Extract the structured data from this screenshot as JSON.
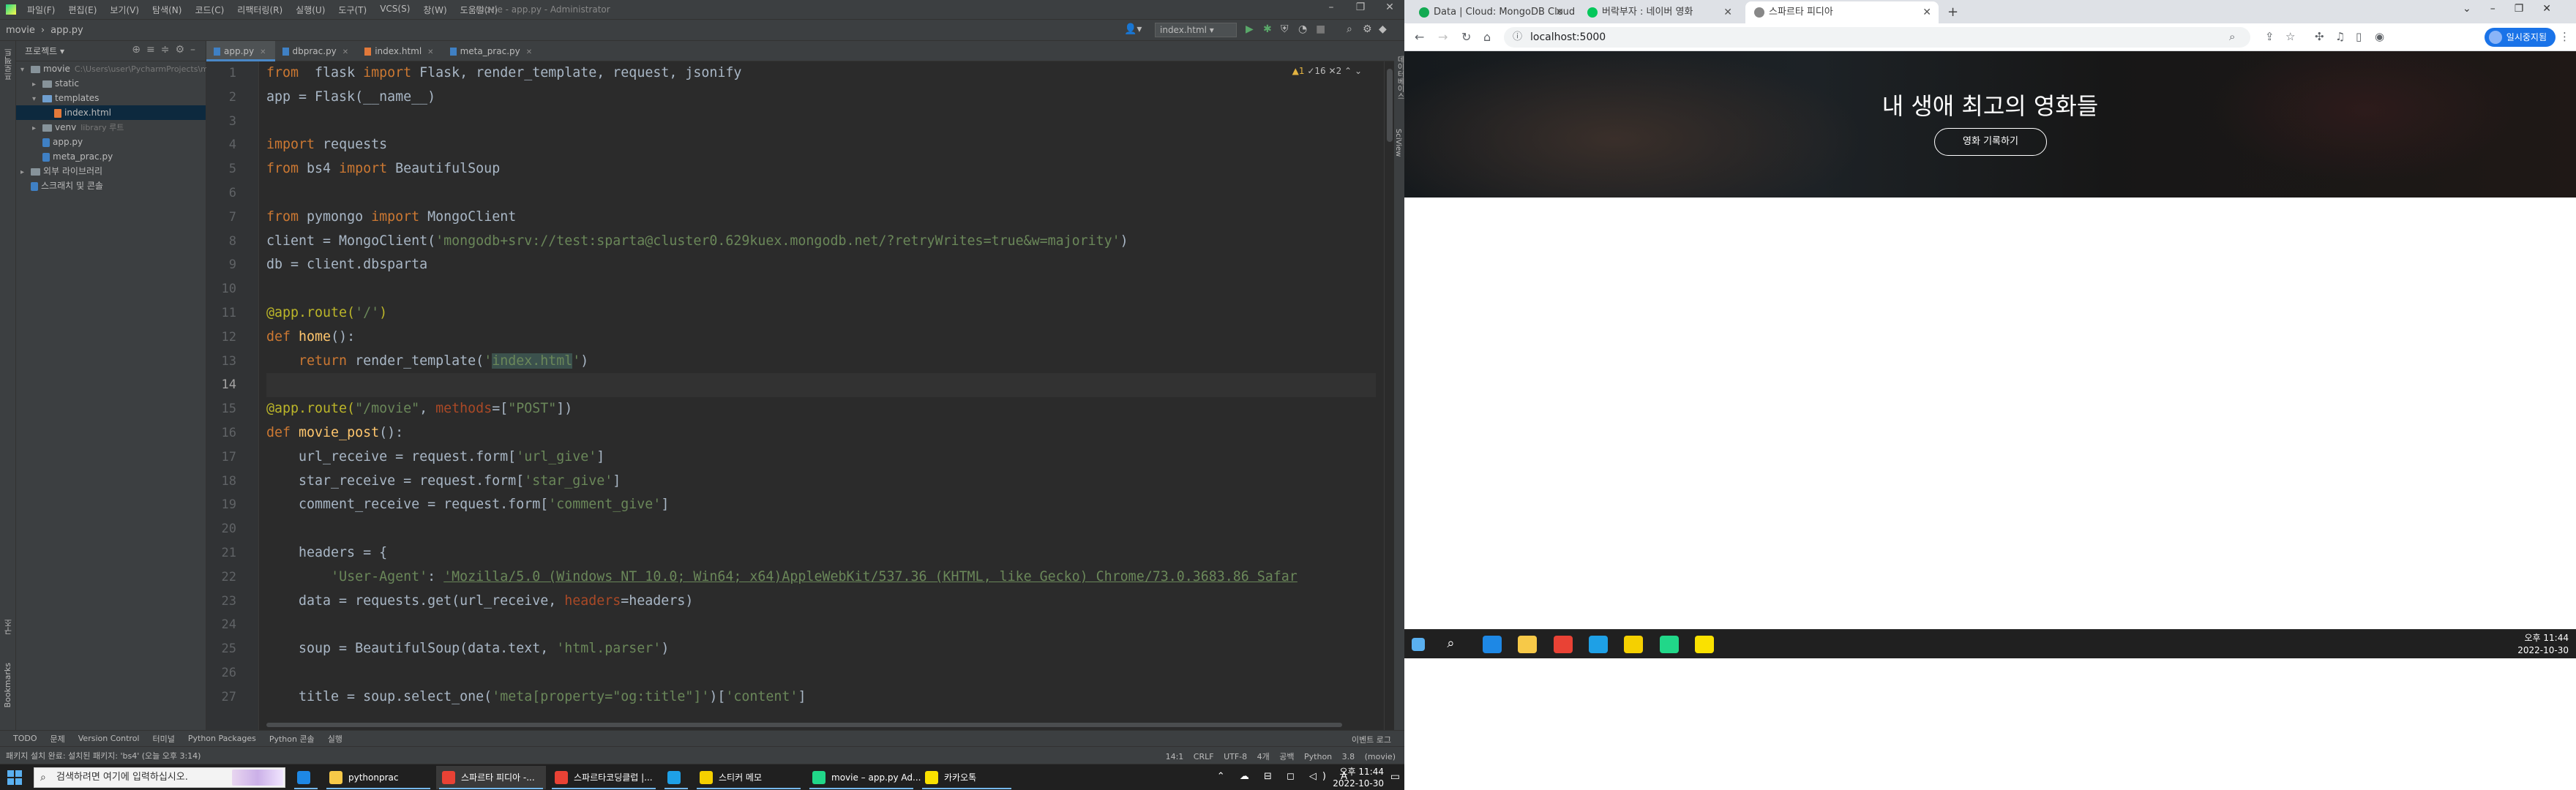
{
  "ide": {
    "menu": [
      "파일(F)",
      "편집(E)",
      "보기(V)",
      "탐색(N)",
      "코드(C)",
      "리팩터링(R)",
      "실행(U)",
      "도구(T)",
      "VCS(S)",
      "창(W)",
      "도움말(H)"
    ],
    "window_title": "movie - app.py - Administrator",
    "breadcrumb": [
      "movie",
      "app.py"
    ],
    "run_config": "index.html",
    "left_strip": [
      "프로젝트",
      "구조",
      "Bookmarks"
    ],
    "right_strip": [
      "데이터베이스",
      "SciView"
    ],
    "project_header": "프로젝트",
    "tree": [
      {
        "label": "movie",
        "hint": "C:\\Users\\user\\PycharmProjects\\movie",
        "kind": "folder",
        "depth": 0,
        "open": true
      },
      {
        "label": "static",
        "hint": "",
        "kind": "folder",
        "depth": 1,
        "open": false
      },
      {
        "label": "templates",
        "hint": "",
        "kind": "folder-blue",
        "depth": 1,
        "open": true
      },
      {
        "label": "index.html",
        "hint": "",
        "kind": "html",
        "depth": 2,
        "selected": true
      },
      {
        "label": "venv",
        "hint": "library 루트",
        "kind": "folder",
        "depth": 1,
        "open": false
      },
      {
        "label": "app.py",
        "hint": "",
        "kind": "py",
        "depth": 1
      },
      {
        "label": "meta_prac.py",
        "hint": "",
        "kind": "py",
        "depth": 1
      },
      {
        "label": "외부 라이브러리",
        "hint": "",
        "kind": "lib",
        "depth": 0,
        "open": false
      },
      {
        "label": "스크래치 및 콘솔",
        "hint": "",
        "kind": "scratch",
        "depth": 0
      }
    ],
    "tabs": [
      {
        "label": "app.py",
        "kind": "py",
        "active": true
      },
      {
        "label": "dbprac.py",
        "kind": "py",
        "active": false
      },
      {
        "label": "index.html",
        "kind": "html",
        "active": false
      },
      {
        "label": "meta_prac.py",
        "kind": "py",
        "active": false
      }
    ],
    "inspection": {
      "warnings": "▲1",
      "weak": "✓16",
      "typos": "✕2"
    },
    "current_line": 14,
    "code_lines": [
      [
        [
          "kw",
          "from"
        ],
        [
          "",
          "  flask "
        ],
        [
          "kw",
          "import"
        ],
        [
          "",
          " Flask, render_template, request, jsonify"
        ]
      ],
      [
        [
          "",
          "app = Flask(__name__)"
        ]
      ],
      [
        [
          "",
          ""
        ]
      ],
      [
        [
          "kw",
          "import"
        ],
        [
          "",
          " requests"
        ]
      ],
      [
        [
          "kw",
          "from"
        ],
        [
          "",
          " bs4 "
        ],
        [
          "kw",
          "import"
        ],
        [
          "",
          " BeautifulSoup"
        ]
      ],
      [
        [
          "",
          ""
        ]
      ],
      [
        [
          "kw",
          "from"
        ],
        [
          "",
          " pymongo "
        ],
        [
          "kw",
          "import"
        ],
        [
          "",
          " MongoClient"
        ]
      ],
      [
        [
          "",
          "client = MongoClient("
        ],
        [
          "str",
          "'mongodb+srv://test:sparta@cluster0.629kuex.mongodb.net/?retryWrites=true&w=majority'"
        ],
        [
          "",
          ")"
        ]
      ],
      [
        [
          "",
          "db = client.dbsparta"
        ]
      ],
      [
        [
          "",
          ""
        ]
      ],
      [
        [
          "dec",
          "@app.route("
        ],
        [
          "str",
          "'/'"
        ],
        [
          "dec",
          ")"
        ]
      ],
      [
        [
          "kw",
          "def "
        ],
        [
          "fn",
          "home"
        ],
        [
          "",
          "():"
        ]
      ],
      [
        [
          "",
          "    "
        ],
        [
          "kw",
          "return"
        ],
        [
          "",
          " render_template("
        ],
        [
          "str",
          "'"
        ],
        [
          "hl",
          "index.html"
        ],
        [
          "str",
          "'"
        ],
        [
          "",
          ")"
        ]
      ],
      [
        [
          "",
          ""
        ]
      ],
      [
        [
          "dec",
          "@app.route("
        ],
        [
          "str",
          "\"/movie\""
        ],
        [
          "",
          ", "
        ],
        [
          "kwarg",
          "methods"
        ],
        [
          "",
          "=["
        ],
        [
          "str",
          "\"POST\""
        ],
        [
          "",
          "])"
        ]
      ],
      [
        [
          "kw",
          "def "
        ],
        [
          "fn",
          "movie_post"
        ],
        [
          "",
          "():"
        ]
      ],
      [
        [
          "",
          "    url_receive = request.form["
        ],
        [
          "str",
          "'url_give'"
        ],
        [
          "",
          "]"
        ]
      ],
      [
        [
          "",
          "    star_receive = request.form["
        ],
        [
          "str",
          "'star_give'"
        ],
        [
          "",
          "]"
        ]
      ],
      [
        [
          "",
          "    comment_receive = request.form["
        ],
        [
          "str",
          "'comment_give'"
        ],
        [
          "",
          "]"
        ]
      ],
      [
        [
          "",
          ""
        ]
      ],
      [
        [
          "",
          "    headers = {"
        ]
      ],
      [
        [
          "",
          "        "
        ],
        [
          "str",
          "'User-Agent'"
        ],
        [
          "",
          ": "
        ],
        [
          "str und",
          "'Mozilla/5.0 (Windows NT 10.0; Win64; x64)AppleWebKit/537.36 (KHTML, like Gecko) Chrome/73.0.3683.86 Safar"
        ]
      ],
      [
        [
          "",
          "    data = requests.get(url_receive, "
        ],
        [
          "kwarg",
          "headers"
        ],
        [
          "",
          "=headers)"
        ]
      ],
      [
        [
          "",
          ""
        ]
      ],
      [
        [
          "",
          "    soup = BeautifulSoup(data.text, "
        ],
        [
          "str",
          "'html.parser'"
        ],
        [
          "",
          ")"
        ]
      ],
      [
        [
          "",
          ""
        ]
      ],
      [
        [
          "",
          "    title = soup.select_one("
        ],
        [
          "str",
          "'meta[property=\"og:title\"]'"
        ],
        [
          "",
          ")["
        ],
        [
          "str",
          "'content'"
        ],
        [
          "",
          "]"
        ]
      ]
    ],
    "toolwindows": [
      "TODO",
      "문제",
      "Version Control",
      "터미널",
      "Python Packages",
      "Python 콘솔",
      "실행"
    ],
    "toolwindow_right": "이벤트 로그",
    "status_message": "패키지 설치 완료: 설치된 패키지: 'bs4' (오늘 오후 3:14)",
    "status_right": [
      "14:1",
      "CRLF",
      "UTF-8",
      "4개 공백",
      "Python 3.8 (movie)"
    ]
  },
  "browser": {
    "tabs": [
      {
        "label": "Data | Cloud: MongoDB Cloud",
        "favicon_color": "#13aa52",
        "active": false
      },
      {
        "label": "버락부자 : 네이버 영화",
        "favicon_color": "#03c75a",
        "active": false
      },
      {
        "label": "스파르타 피디아",
        "favicon_color": "#888888",
        "active": true
      }
    ],
    "url": "localhost:5000",
    "sync_label": "일시중지됨",
    "page": {
      "hero_title": "내 생애 최고의 영화들",
      "hero_button": "영화 기록하기"
    }
  },
  "taskbar2": {
    "time": "오후 11:44",
    "date": "2022-10-30",
    "icons": [
      {
        "name": "windows-start-icon",
        "color": "#5ab0f0"
      },
      {
        "name": "search-icon",
        "color": "#ffffff"
      },
      {
        "name": "edge-icon",
        "color": "#1e88e5"
      },
      {
        "name": "file-explorer-icon",
        "color": "#f7c948"
      },
      {
        "name": "chrome-icon",
        "color": "#e94235"
      },
      {
        "name": "internet-explorer-icon",
        "color": "#1ea0e6"
      },
      {
        "name": "sticky-notes-icon",
        "color": "#f5d000"
      },
      {
        "name": "pycharm-icon",
        "color": "#21d789"
      },
      {
        "name": "kakaotalk-icon",
        "color": "#fae100"
      }
    ]
  },
  "taskbar": {
    "search_placeholder": "검색하려면 여기에 입력하십시오.",
    "apps": [
      {
        "label": "",
        "color": "#1e88e5",
        "active": false,
        "name": "edge-taskbar-app"
      },
      {
        "label": "pythonprac",
        "color": "#f7c948",
        "active": false,
        "name": "explorer-taskbar-app"
      },
      {
        "label": "스파르타 피디아 -...",
        "color": "#e94235",
        "active": true,
        "name": "chrome-taskbar-app-1"
      },
      {
        "label": "스파르타코딩클럽 |...",
        "color": "#e94235",
        "active": false,
        "name": "chrome-taskbar-app-2"
      },
      {
        "label": "",
        "color": "#1ea0e6",
        "active": false,
        "name": "ie-taskbar-app"
      },
      {
        "label": "스티커 메모",
        "color": "#f5d000",
        "active": false,
        "name": "sticky-notes-taskbar-app"
      },
      {
        "label": "movie – app.py Ad...",
        "color": "#21d789",
        "active": false,
        "name": "pycharm-taskbar-app"
      },
      {
        "label": "카카오톡",
        "color": "#fae100",
        "active": false,
        "name": "kakaotalk-taskbar-app"
      }
    ],
    "time": "오후 11:44",
    "date": "2022-10-30"
  }
}
